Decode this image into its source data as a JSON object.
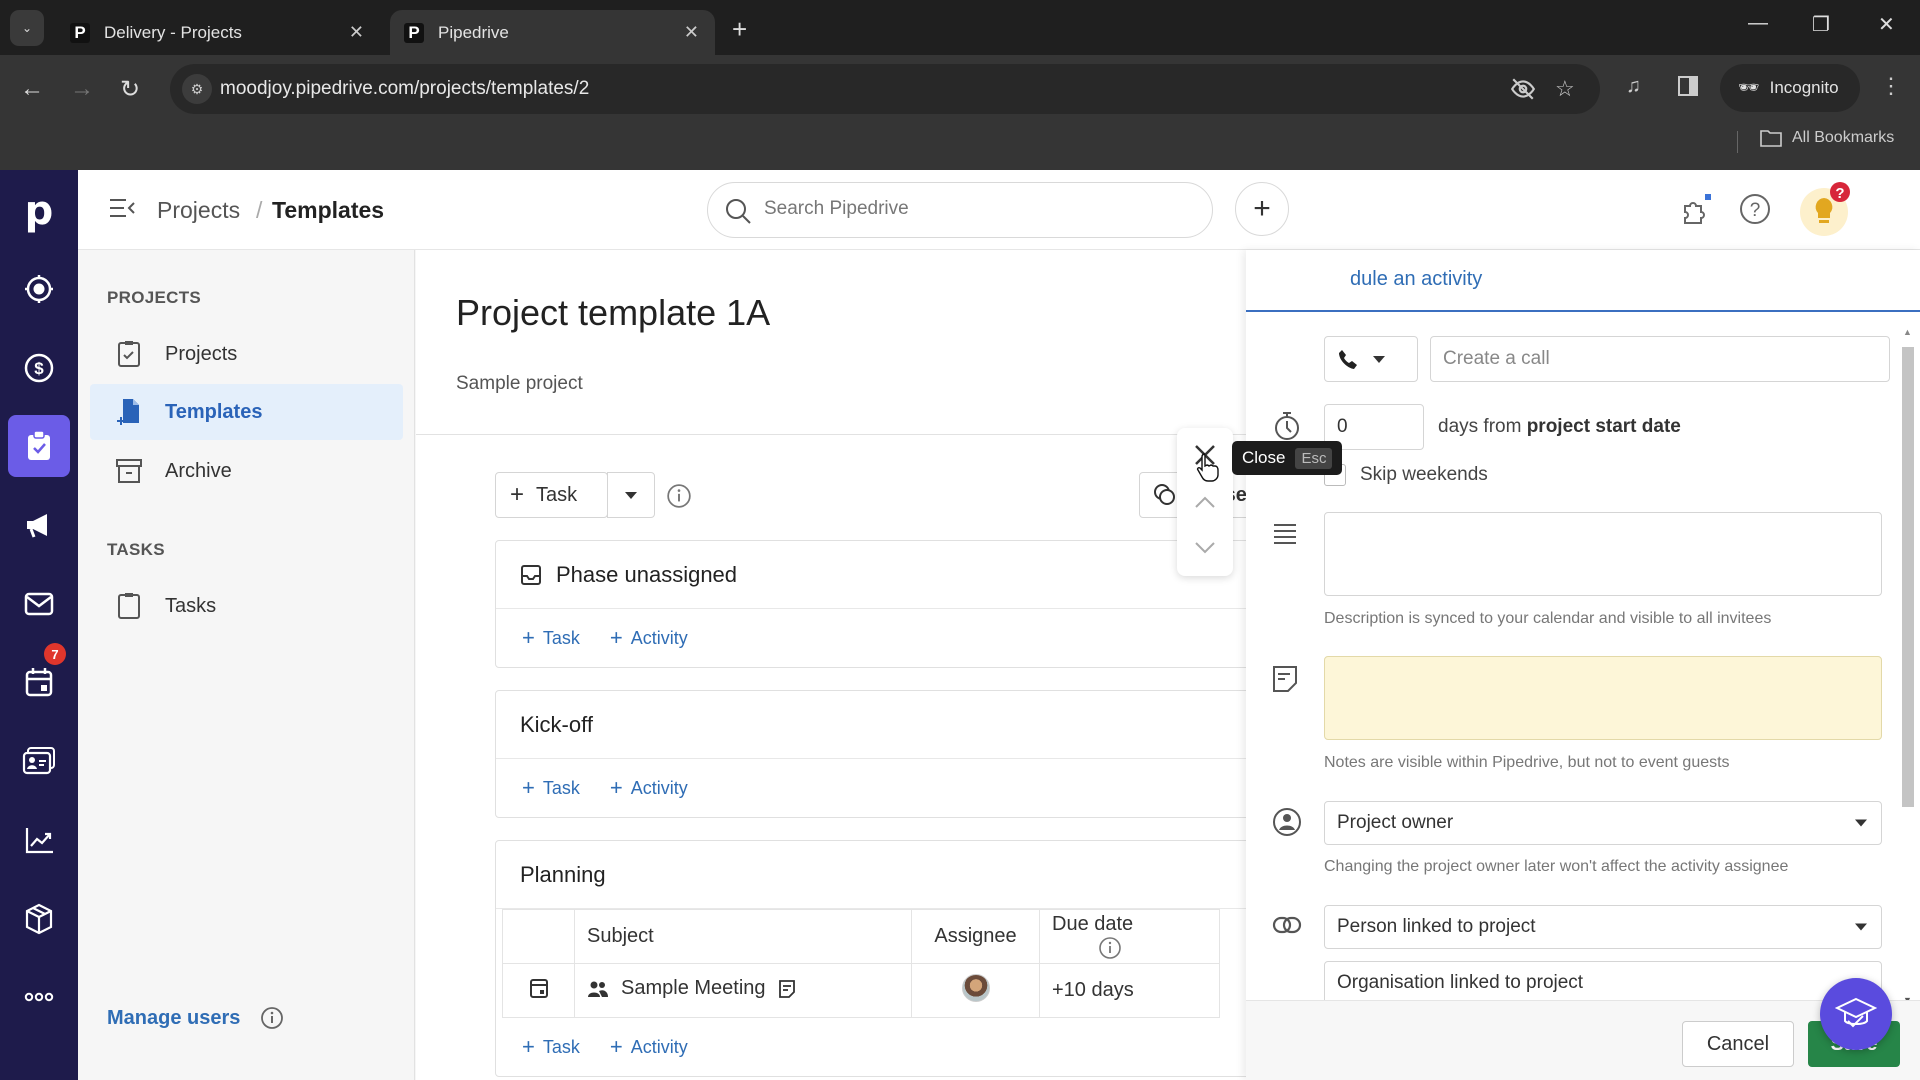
{
  "browser": {
    "tabs": [
      {
        "title": "Delivery - Projects",
        "favicon": "P",
        "active": false
      },
      {
        "title": "Pipedrive",
        "favicon": "P",
        "active": true
      }
    ],
    "url": "moodjoy.pipedrive.com/projects/templates/2",
    "profile_label": "Incognito",
    "bookmarks_label": "All Bookmarks"
  },
  "app": {
    "logo": "p",
    "rail_items": [
      {
        "name": "leads",
        "icon": "target-icon"
      },
      {
        "name": "deals",
        "icon": "dollar-icon"
      },
      {
        "name": "projects",
        "icon": "clipboard-check-icon",
        "active": true
      },
      {
        "name": "campaigns",
        "icon": "megaphone-icon"
      },
      {
        "name": "mail",
        "icon": "mail-icon"
      },
      {
        "name": "activities",
        "icon": "calendar-icon",
        "badge": "7"
      },
      {
        "name": "contacts",
        "icon": "contact-card-icon"
      },
      {
        "name": "insights",
        "icon": "chart-icon"
      },
      {
        "name": "products",
        "icon": "box-icon"
      },
      {
        "name": "more",
        "icon": "more-icon"
      }
    ],
    "breadcrumb": {
      "parent": "Projects",
      "separator": "/",
      "current": "Templates"
    },
    "search_placeholder": "Search Pipedrive",
    "help_badge": "?"
  },
  "sidebar": {
    "projects_section": "PROJECTS",
    "items": [
      {
        "label": "Projects",
        "active": false
      },
      {
        "label": "Templates",
        "active": true
      },
      {
        "label": "Archive",
        "active": false
      }
    ],
    "tasks_section": "TASKS",
    "task_items": [
      {
        "label": "Tasks"
      }
    ],
    "manage_users": "Manage users"
  },
  "main": {
    "title": "Project template 1A",
    "subtitle": "Sample project",
    "add_task_label": "Task",
    "phases_label": "Phases",
    "add_task_link": "Task",
    "add_activity_link": "Activity",
    "phases": [
      {
        "name": "Phase unassigned",
        "has_icon": true
      },
      {
        "name": "Kick-off"
      },
      {
        "name": "Planning"
      }
    ],
    "table": {
      "columns": [
        "Subject",
        "Assignee",
        "Due date"
      ],
      "rows": [
        {
          "subject": "Sample Meeting",
          "assignee": "avatar",
          "due": "+10 days"
        }
      ]
    }
  },
  "tooltip": {
    "label": "Close",
    "shortcut": "Esc"
  },
  "panel": {
    "title": "Schedule an activity",
    "title_visible": "dule an activity",
    "activity_type": "call",
    "subject_placeholder": "Create a call",
    "days_value": "0",
    "days_text": "days from",
    "days_anchor": "project start date",
    "skip_weekends_label": "Skip weekends",
    "skip_weekends_checked": false,
    "description_hint": "Description is synced to your calendar and visible to all invitees",
    "notes_hint": "Notes are visible within Pipedrive, but not to event guests",
    "assignee_value": "Project owner",
    "assignee_hint": "Changing the project owner later won't affect the activity assignee",
    "person_value": "Person linked to project",
    "org_value": "Organisation linked to project",
    "cancel_label": "Cancel",
    "save_label": "Save"
  },
  "colors": {
    "rail_bg": "#1e1b4b",
    "rail_active": "#6b5ce7",
    "link_blue": "#2f6db5",
    "save_green": "#268548",
    "notes_yellow": "#fdf6d8",
    "badge_red": "#e0362c"
  }
}
